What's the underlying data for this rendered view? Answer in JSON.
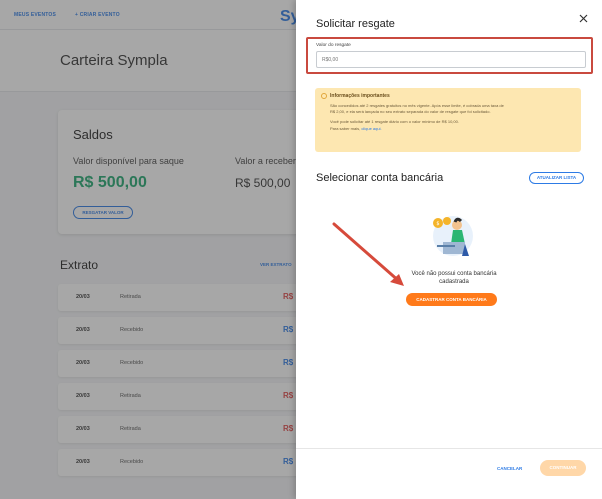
{
  "topbar": {
    "nav_items": [
      "MEUS EVENTOS",
      "+ CRIAR EVENTO"
    ],
    "logo_text": "Sy"
  },
  "page": {
    "title": "Carteira Sympla"
  },
  "saldos": {
    "title": "Saldos",
    "available_label": "Valor disponível para saque",
    "receivable_label": "Valor a receber",
    "available_value": "R$ 500,00",
    "receivable_value": "R$ 500,00",
    "withdraw_button": "RESGATAR VALOR"
  },
  "extrato": {
    "title": "Extrato",
    "link": "VER EXTRATO",
    "rows": [
      {
        "date": "20/03",
        "type": "Retirada",
        "amount": "R$",
        "color": "#e04a4a"
      },
      {
        "date": "20/03",
        "type": "Recebido",
        "amount": "R$",
        "color": "#2d7be5"
      },
      {
        "date": "20/03",
        "type": "Recebido",
        "amount": "R$",
        "color": "#2d7be5"
      },
      {
        "date": "20/03",
        "type": "Retirada",
        "amount": "R$",
        "color": "#e04a4a"
      },
      {
        "date": "20/03",
        "type": "Retirada",
        "amount": "R$",
        "color": "#e04a4a"
      },
      {
        "date": "20/03",
        "type": "Recebido",
        "amount": "R$",
        "color": "#2d7be5"
      }
    ]
  },
  "drawer": {
    "title": "Solicitar resgate",
    "close_icon": "close-icon",
    "field_label": "Valor do resgate",
    "field_placeholder": "R$0,00",
    "info": {
      "heading": "Informações importantes",
      "line1": "São concedidos até 2 resgates gratuitos no mês vigente. Após esse limite, é cobrada uma taxa de",
      "line2": "R$ 2,00, e ela será lançada no seu extrato separada do valor de resgate que foi solicitado.",
      "line3": "Você pode solicitar até 1 resgate diário com o valor mínimo de R$ 10,00.",
      "line4_prefix": "Para saber mais, ",
      "line4_link": "clique aqui."
    },
    "select_account_title": "Selecionar conta bancária",
    "refresh_button": "ATUALIZAR LISTA",
    "empty_message": "Você não possui conta bancária cadastrada",
    "register_button": "CADASTRAR CONTA BANCÁRIA",
    "cancel_button": "CANCELAR",
    "continue_button": "CONTINUAR"
  },
  "colors": {
    "accent": "#2d7be5",
    "success": "#1fa870",
    "highlight_border": "#c94a3f",
    "primary_button": "#ff7a1a",
    "info_bg": "#fde7b1"
  }
}
